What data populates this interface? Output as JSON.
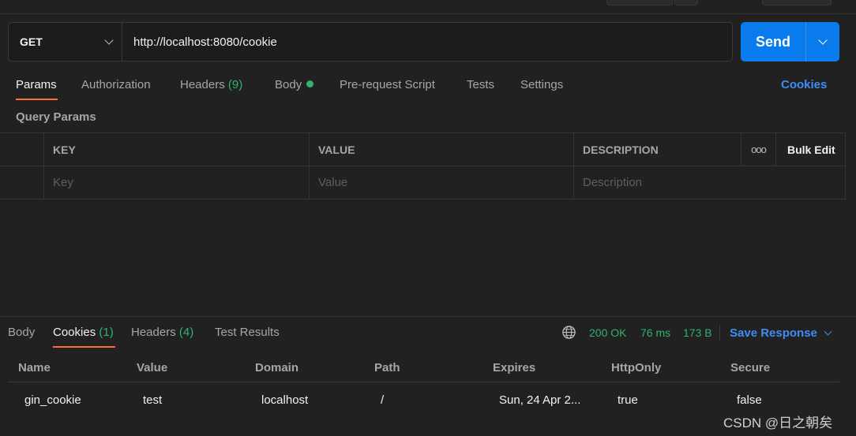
{
  "request": {
    "method": "GET",
    "url": "http://localhost:8080/cookie",
    "send_label": "Send"
  },
  "request_tabs": {
    "params": "Params",
    "authorization": "Authorization",
    "headers": "Headers",
    "headers_count": "(9)",
    "body": "Body",
    "prerequest": "Pre-request Script",
    "tests": "Tests",
    "settings": "Settings",
    "cookies_link": "Cookies"
  },
  "query_params": {
    "title": "Query Params",
    "columns": {
      "key": "KEY",
      "value": "VALUE",
      "description": "DESCRIPTION",
      "more": "ooo",
      "bulk_edit": "Bulk Edit"
    },
    "placeholders": {
      "key": "Key",
      "value": "Value",
      "description": "Description"
    }
  },
  "response_tabs": {
    "body": "Body",
    "cookies": "Cookies",
    "cookies_count": "(1)",
    "headers": "Headers",
    "headers_count": "(4)",
    "test_results": "Test Results"
  },
  "response_status": {
    "status": "200 OK",
    "time": "76 ms",
    "size": "173 B",
    "save_response": "Save Response"
  },
  "cookies_table": {
    "columns": [
      "Name",
      "Value",
      "Domain",
      "Path",
      "Expires",
      "HttpOnly",
      "Secure"
    ],
    "rows": [
      [
        "gin_cookie",
        "test",
        "localhost",
        "/",
        "Sun, 24 Apr 2...",
        "true",
        "false"
      ]
    ]
  },
  "watermark": "CSDN @日之朝矣",
  "colors": {
    "accent": "#ff6c37",
    "send_button": "#097bed",
    "link": "#3f8df1",
    "success": "#2fb36d"
  }
}
